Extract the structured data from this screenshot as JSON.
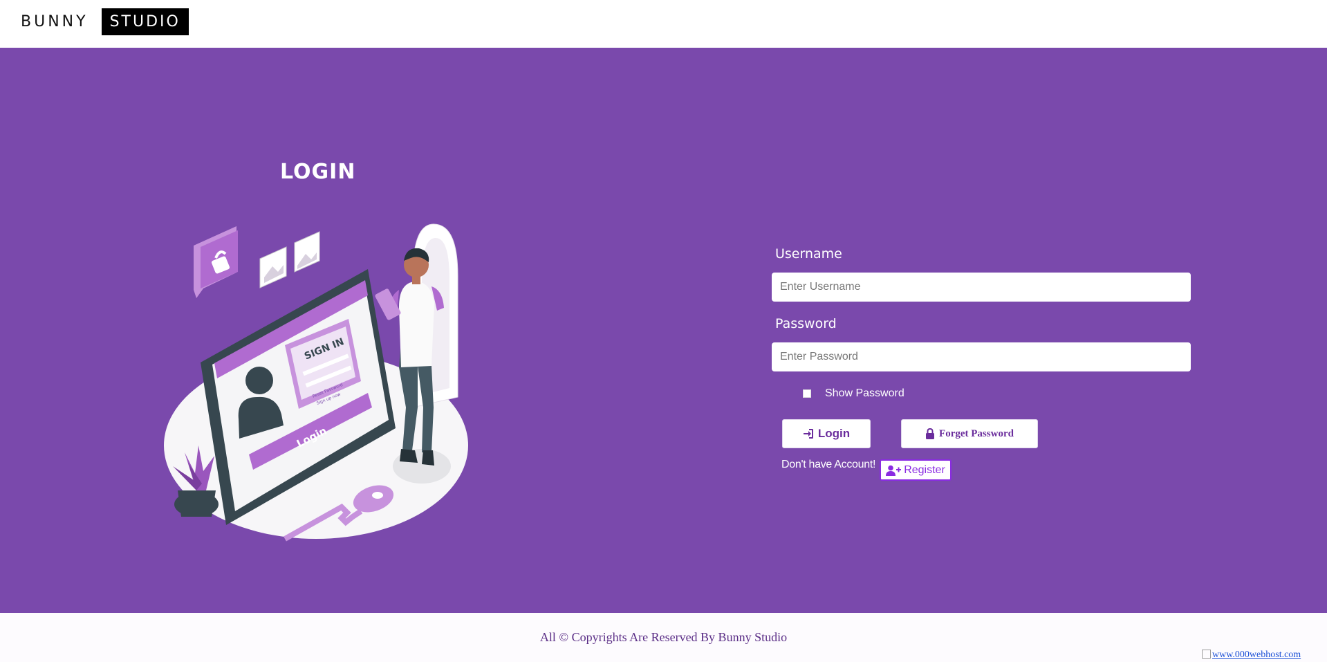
{
  "header": {
    "brand_part1": "BUNNY",
    "brand_part2": "STUDIO"
  },
  "hero": {
    "title": "LOGIN",
    "illustration": "login-illustration",
    "illustration_texts": {
      "sign_in": "SIGN IN",
      "reset": "Reset Password",
      "signup": "Sign up now",
      "login": "Login"
    }
  },
  "form": {
    "username_label": "Username",
    "username_placeholder": "Enter Username",
    "password_label": "Password",
    "password_placeholder": "Enter Password",
    "show_password_label": "Show Password",
    "login_button": "Login",
    "login_icon": "sign-in-icon",
    "forget_button": "Forget Password",
    "forget_icon": "lock-icon",
    "no_account_text": "Don't have Account!",
    "register_button": "Register",
    "register_icon": "user-plus-icon"
  },
  "footer": {
    "copyright": "All © Copyrights Are Reserved By Bunny Studio",
    "host_badge": "www.000webhost.com"
  },
  "colors": {
    "primary": "#7a49ac",
    "accent": "#8a2be2"
  }
}
